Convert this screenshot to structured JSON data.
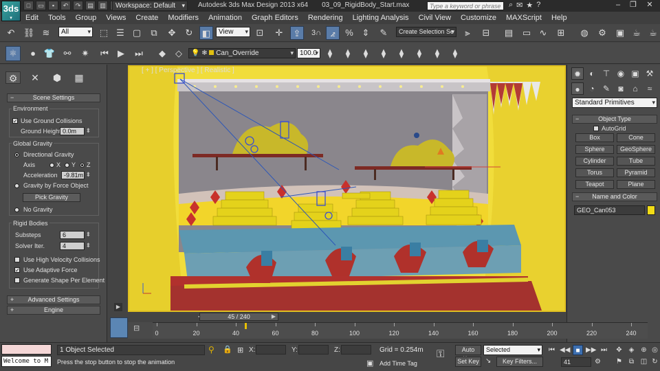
{
  "titlebar": {
    "logo": "3ds",
    "workspace": "Workspace: Default",
    "app_name": "Autodesk 3ds Max Design 2013 x64",
    "file_name": "03_09_RigidBody_Start.max",
    "help_search_placeholder": "Type a keyword or phrase",
    "minimize": "–",
    "maximize": "❐",
    "close": "✕"
  },
  "menu": [
    "Edit",
    "Tools",
    "Group",
    "Views",
    "Create",
    "Modifiers",
    "Animation",
    "Graph Editors",
    "Rendering",
    "Lighting Analysis",
    "Civil View",
    "Customize",
    "MAXScript",
    "Help"
  ],
  "toolbar1": {
    "selection_filter": "All",
    "ref_coord": "View",
    "snap_label": "3",
    "named_selection": "Create Selection Se"
  },
  "toolbar2": {
    "layer": "Can_Override",
    "value": "100.0"
  },
  "left_panel": {
    "rollout_scene": "Scene Settings",
    "environment": "Environment",
    "use_ground_collisions": "Use Ground Collisions",
    "ground_height_label": "Ground Height",
    "ground_height": "0.0m",
    "global_gravity": "Global Gravity",
    "directional_gravity": "Directional Gravity",
    "axis_label": "Axis",
    "axis_x": "X",
    "axis_y": "Y",
    "axis_z": "Z",
    "acceleration_label": "Acceleration",
    "acceleration": "-9.81m",
    "gravity_by_force": "Gravity by Force Object",
    "pick_gravity": "Pick Gravity",
    "no_gravity": "No Gravity",
    "rigid_bodies": "Rigid Bodies",
    "substeps_label": "Substeps",
    "substeps": "6",
    "solver_iter_label": "Solver Iter.",
    "solver_iter": "4",
    "high_velocity": "Use High Velocity Collisions",
    "adaptive_force": "Use Adaptive Force",
    "generate_shape": "Generate Shape Per Element",
    "rollout_advanced": "Advanced Settings",
    "rollout_engine": "Engine",
    "plus": "+"
  },
  "viewport": {
    "label": "[ + ] [ Perspective ] [ Realistic ]"
  },
  "right_panel": {
    "category": "Standard Primitives",
    "object_type": "Object Type",
    "autogrid": "AutoGrid",
    "primitives": [
      "Box",
      "Cone",
      "Sphere",
      "GeoSphere",
      "Cylinder",
      "Tube",
      "Torus",
      "Pyramid",
      "Teapot",
      "Plane"
    ],
    "name_and_color": "Name and Color",
    "object_name": "GEO_Can053",
    "object_color": "#f2dc16"
  },
  "timeline": {
    "slider_label": "45 / 240",
    "current_frame": 45,
    "total_frames": 240,
    "ticks": [
      0,
      20,
      40,
      60,
      80,
      100,
      120,
      140,
      160,
      180,
      200,
      220,
      240
    ]
  },
  "status": {
    "listener_text": "Welcome to M",
    "selection": "1 Object Selected",
    "prompt": "Press the stop button to stop the animation",
    "x_label": "X:",
    "y_label": "Y:",
    "z_label": "Z:",
    "grid": "Grid = 0.254m",
    "add_time_tag": "Add Time Tag",
    "auto_key": "Auto Key",
    "set_key": "Set Key",
    "key_filter": "Selected",
    "key_filters_btn": "Key Filters...",
    "frame_field": "41"
  }
}
